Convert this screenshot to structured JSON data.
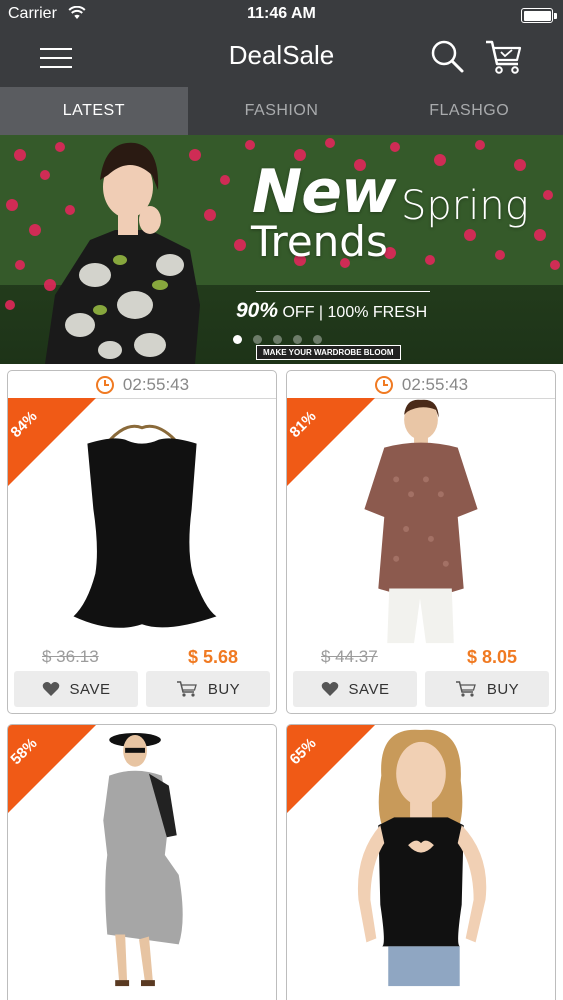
{
  "status_bar": {
    "carrier": "Carrier",
    "time": "11:46 AM",
    "battery_level": 1.0
  },
  "nav": {
    "title": "DealSale",
    "menu_icon": "hamburger-menu-icon",
    "search_icon": "search-icon",
    "cart_icon": "shopping-cart-icon"
  },
  "tabs": [
    {
      "label": "LATEST",
      "active": true
    },
    {
      "label": "FASHION",
      "active": false
    },
    {
      "label": "FLASHGO",
      "active": false
    }
  ],
  "banner": {
    "headline": "New",
    "headline_2": "Spring",
    "headline_3": "Trends",
    "offer_big": "90%",
    "offer_rest": "OFF  |  100% FRESH",
    "cta": "MAKE YOUR WARDROBE BLOOM",
    "slide_count": 5,
    "active_slide": 0
  },
  "products": [
    {
      "timer": "02:55:43",
      "discount": "84%",
      "old_price": "$ 36.13",
      "new_price": "$ 5.68",
      "save_label": "SAVE",
      "buy_label": "BUY"
    },
    {
      "timer": "02:55:43",
      "discount": "81%",
      "old_price": "$ 44.37",
      "new_price": "$ 8.05",
      "save_label": "SAVE",
      "buy_label": "BUY"
    },
    {
      "discount": "58%"
    },
    {
      "discount": "65%"
    }
  ],
  "colors": {
    "nav_bg": "#3a3c3f",
    "tab_active_bg": "#5a5c60",
    "discount_orange": "#f05a16",
    "price_orange": "#f07a22"
  }
}
